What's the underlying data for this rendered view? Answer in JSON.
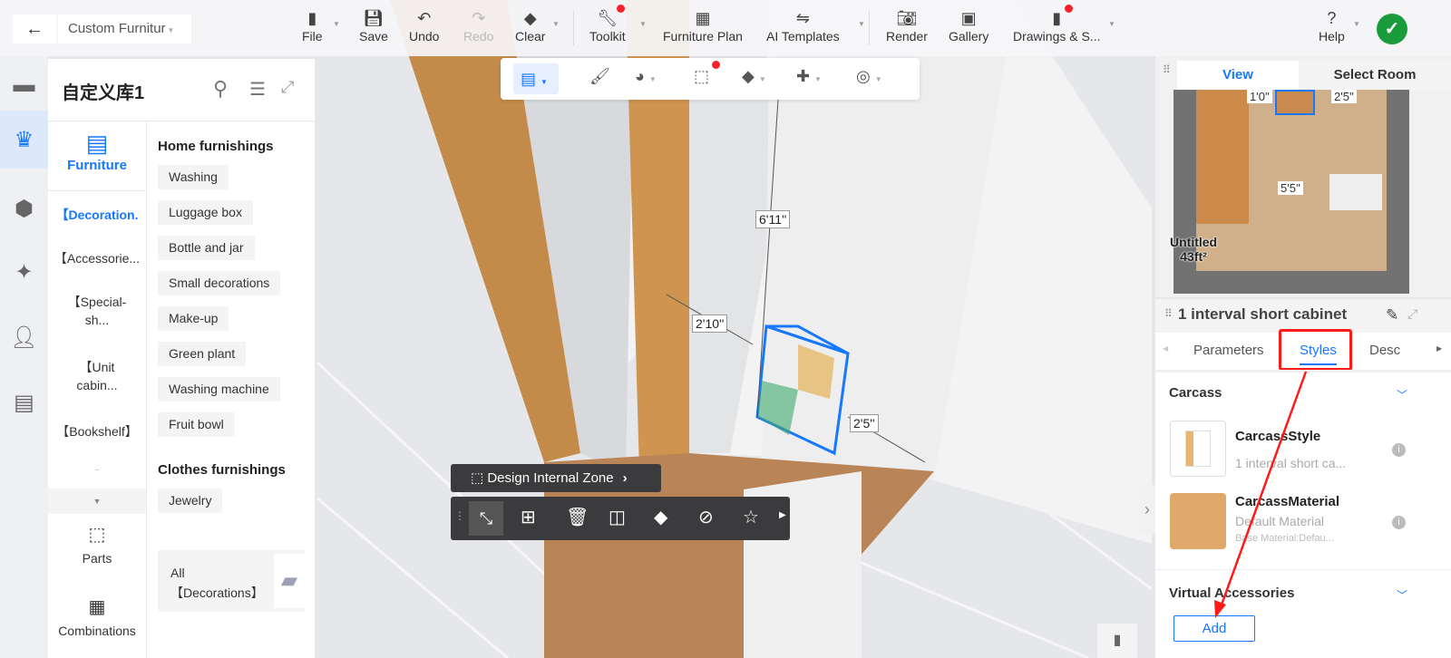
{
  "topbar": {
    "back_icon": "arrow-left-icon",
    "design_name": "Custom Furnitur",
    "items": [
      {
        "label": "File",
        "icon": "file-icon"
      },
      {
        "label": "Save",
        "icon": "save-icon"
      },
      {
        "label": "Undo",
        "icon": "undo-icon"
      },
      {
        "label": "Redo",
        "icon": "redo-icon"
      },
      {
        "label": "Clear",
        "icon": "eraser-icon"
      },
      {
        "label": "Toolkit",
        "icon": "wrench-icon"
      },
      {
        "label": "Furniture Plan",
        "icon": "plan-icon"
      },
      {
        "label": "AI Templates",
        "icon": "ai-icon"
      },
      {
        "label": "Render",
        "icon": "camera-icon"
      },
      {
        "label": "Gallery",
        "icon": "gallery-icon"
      },
      {
        "label": "Drawings & S...",
        "icon": "drawings-icon"
      },
      {
        "label": "Help",
        "icon": "help-icon"
      }
    ],
    "status_icon": "check-icon"
  },
  "library": {
    "title": "自定义库1",
    "tab_label": "Furniture",
    "categories": [
      "【Decoration.",
      "【Accessorie...",
      "【Special-sh...",
      "【Unit cabin...",
      "【Bookshelf】",
      "-"
    ],
    "sections": [
      {
        "title": "Home furnishings",
        "tags": [
          "Washing",
          "Luggage box",
          "Bottle and jar",
          "Small decorations",
          "Make-up",
          "Green plant",
          "Washing machine",
          "Fruit bowl"
        ]
      },
      {
        "title": "Clothes furnishings",
        "tags": [
          "Jewelry"
        ]
      }
    ],
    "all_card": "All 【Decorations】",
    "bottom_tabs": [
      "Parts",
      "Combinations"
    ]
  },
  "viewport": {
    "dims": [
      "6'11''",
      "2'10''",
      "2'5''"
    ],
    "zone_label": "Design Internal Zone"
  },
  "minimap": {
    "tabs": [
      "View",
      "Select Room"
    ],
    "dims": [
      "1'0''",
      "2'5''",
      "5'5''"
    ],
    "room_name": "Untitled",
    "room_area": "43ft²"
  },
  "props": {
    "title": "1 interval short cabinet",
    "tabs": [
      "Parameters",
      "Styles",
      "Desc"
    ],
    "active_tab": "Styles",
    "carcass": {
      "title": "Carcass",
      "items": [
        {
          "name": "CarcassStyle",
          "sub": "1 interval short ca..."
        },
        {
          "name": "CarcassMaterial",
          "sub": "Default Material",
          "sub2": "Base Material:Defau..."
        }
      ]
    },
    "accessories": {
      "title": "Virtual Accessories",
      "add_label": "Add"
    }
  },
  "colors": {
    "accent": "#1677ff",
    "annotation": "#ff1a1a",
    "success": "#1a9b3c"
  }
}
